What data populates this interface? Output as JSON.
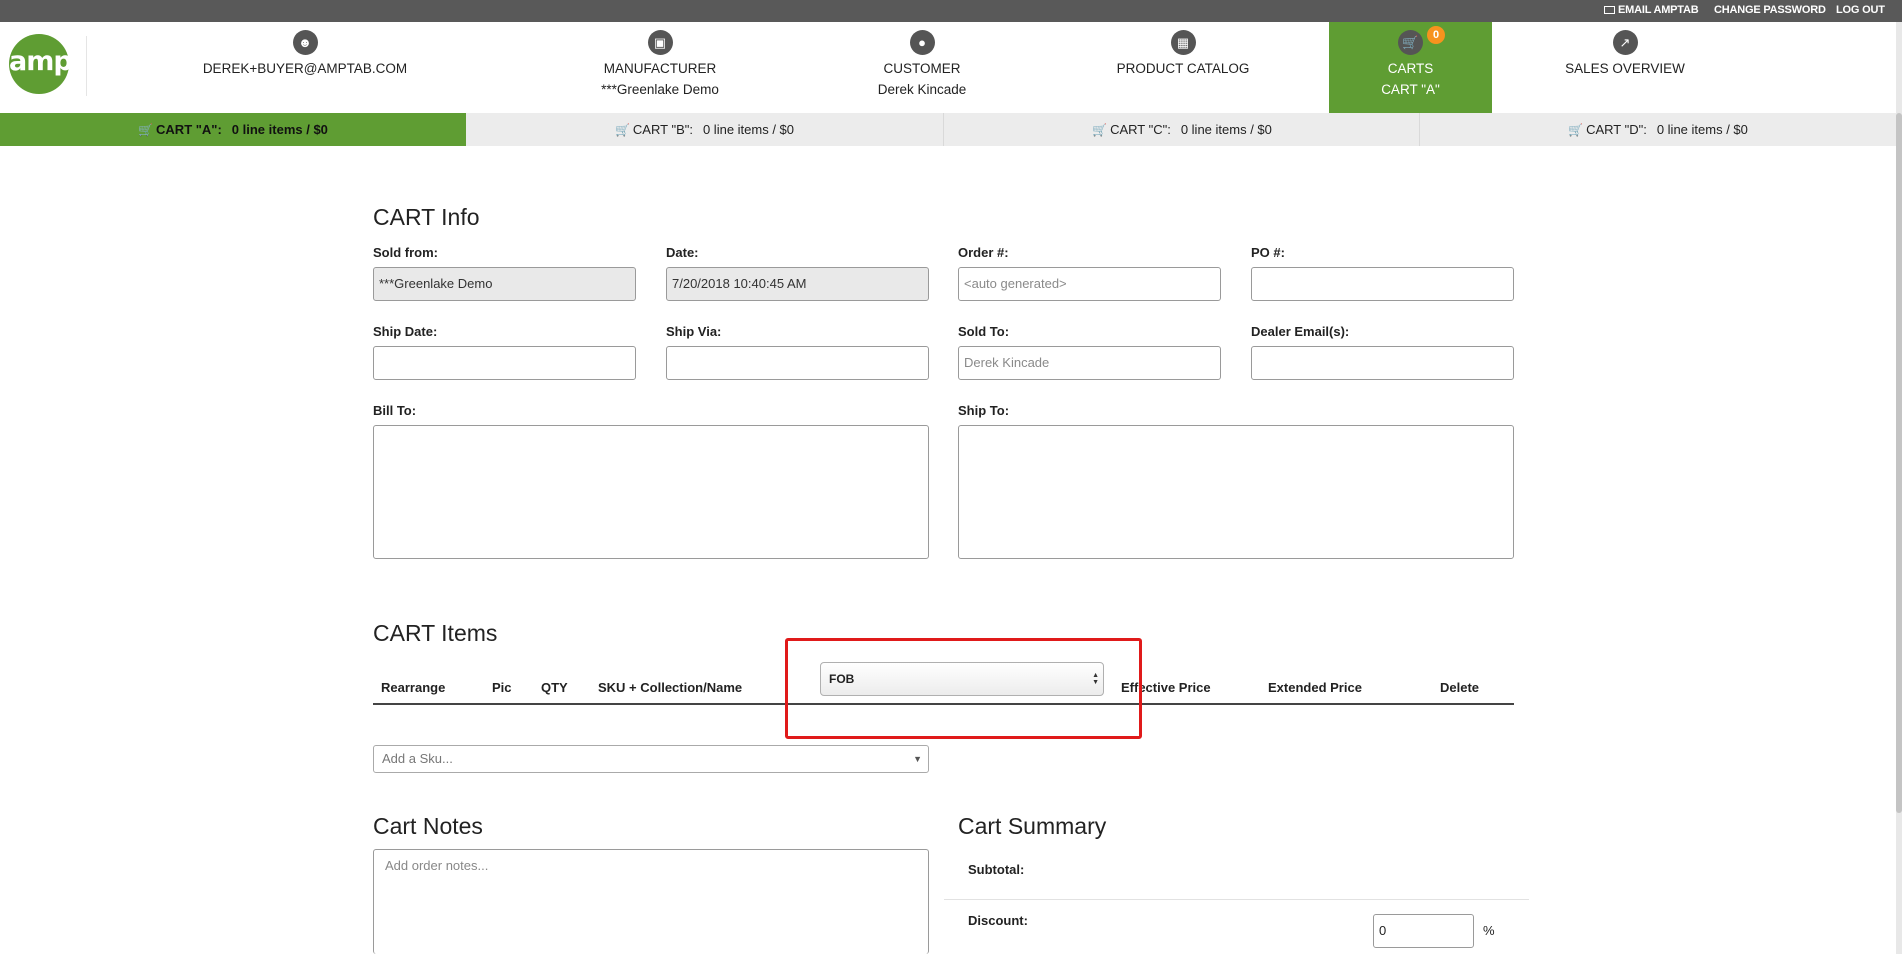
{
  "topbar": {
    "email_link": "EMAIL AMPTAB",
    "change_password": "CHANGE PASSWORD",
    "logout": "LOG OUT"
  },
  "logo": {
    "text": "amp"
  },
  "nav": {
    "user": {
      "label": "DEREK+BUYER@AMPTAB.COM",
      "icon": "user-icon"
    },
    "manufacturer": {
      "label": "MANUFACTURER",
      "sub": "***Greenlake Demo",
      "icon": "factory-icon"
    },
    "customer": {
      "label": "CUSTOMER",
      "sub": "Derek Kincade",
      "icon": "users-icon"
    },
    "catalog": {
      "label": "PRODUCT CATALOG",
      "icon": "grid-icon"
    },
    "carts": {
      "label": "CARTS",
      "sub": "CART \"A\"",
      "icon": "cart-icon",
      "badge": "0"
    },
    "sales": {
      "label": "SALES OVERVIEW",
      "icon": "chart-icon"
    }
  },
  "cart_tabs": [
    {
      "name": "CART \"A\":",
      "summary": "0 line items / $0"
    },
    {
      "name": "CART \"B\":",
      "summary": "0 line items / $0"
    },
    {
      "name": "CART \"C\":",
      "summary": "0 line items / $0"
    },
    {
      "name": "CART \"D\":",
      "summary": "0 line items / $0"
    }
  ],
  "cart_info": {
    "title": "CART Info",
    "sold_from": {
      "label": "Sold from:",
      "value": "***Greenlake Demo"
    },
    "date": {
      "label": "Date:",
      "value": "7/20/2018 10:40:45 AM"
    },
    "order": {
      "label": "Order #:",
      "placeholder": "<auto generated>"
    },
    "po": {
      "label": "PO #:",
      "value": ""
    },
    "ship_date": {
      "label": "Ship Date:",
      "value": ""
    },
    "ship_via": {
      "label": "Ship Via:",
      "value": ""
    },
    "sold_to": {
      "label": "Sold To:",
      "placeholder": "Derek Kincade"
    },
    "dealer_email": {
      "label": "Dealer Email(s):",
      "value": ""
    },
    "bill_to": {
      "label": "Bill To:"
    },
    "ship_to": {
      "label": "Ship To:"
    }
  },
  "cart_items": {
    "title": "CART Items",
    "columns": {
      "rearrange": "Rearrange",
      "pic": "Pic",
      "qty": "QTY",
      "sku": "SKU + Collection/Name",
      "price_type": "FOB",
      "effective": "Effective Price",
      "extended": "Extended Price",
      "delete": "Delete"
    },
    "add_sku_placeholder": "Add a Sku..."
  },
  "cart_notes": {
    "title": "Cart Notes",
    "placeholder": "Add order notes..."
  },
  "cart_summary": {
    "title": "Cart Summary",
    "subtotal_label": "Subtotal:",
    "discount_label": "Discount:",
    "discount_value": "0",
    "discount_unit": "%"
  },
  "colors": {
    "brand_green": "#5f9d33",
    "badge_orange": "#f7931e",
    "highlight_red": "#e01a1a",
    "topbar_gray": "#595959"
  }
}
